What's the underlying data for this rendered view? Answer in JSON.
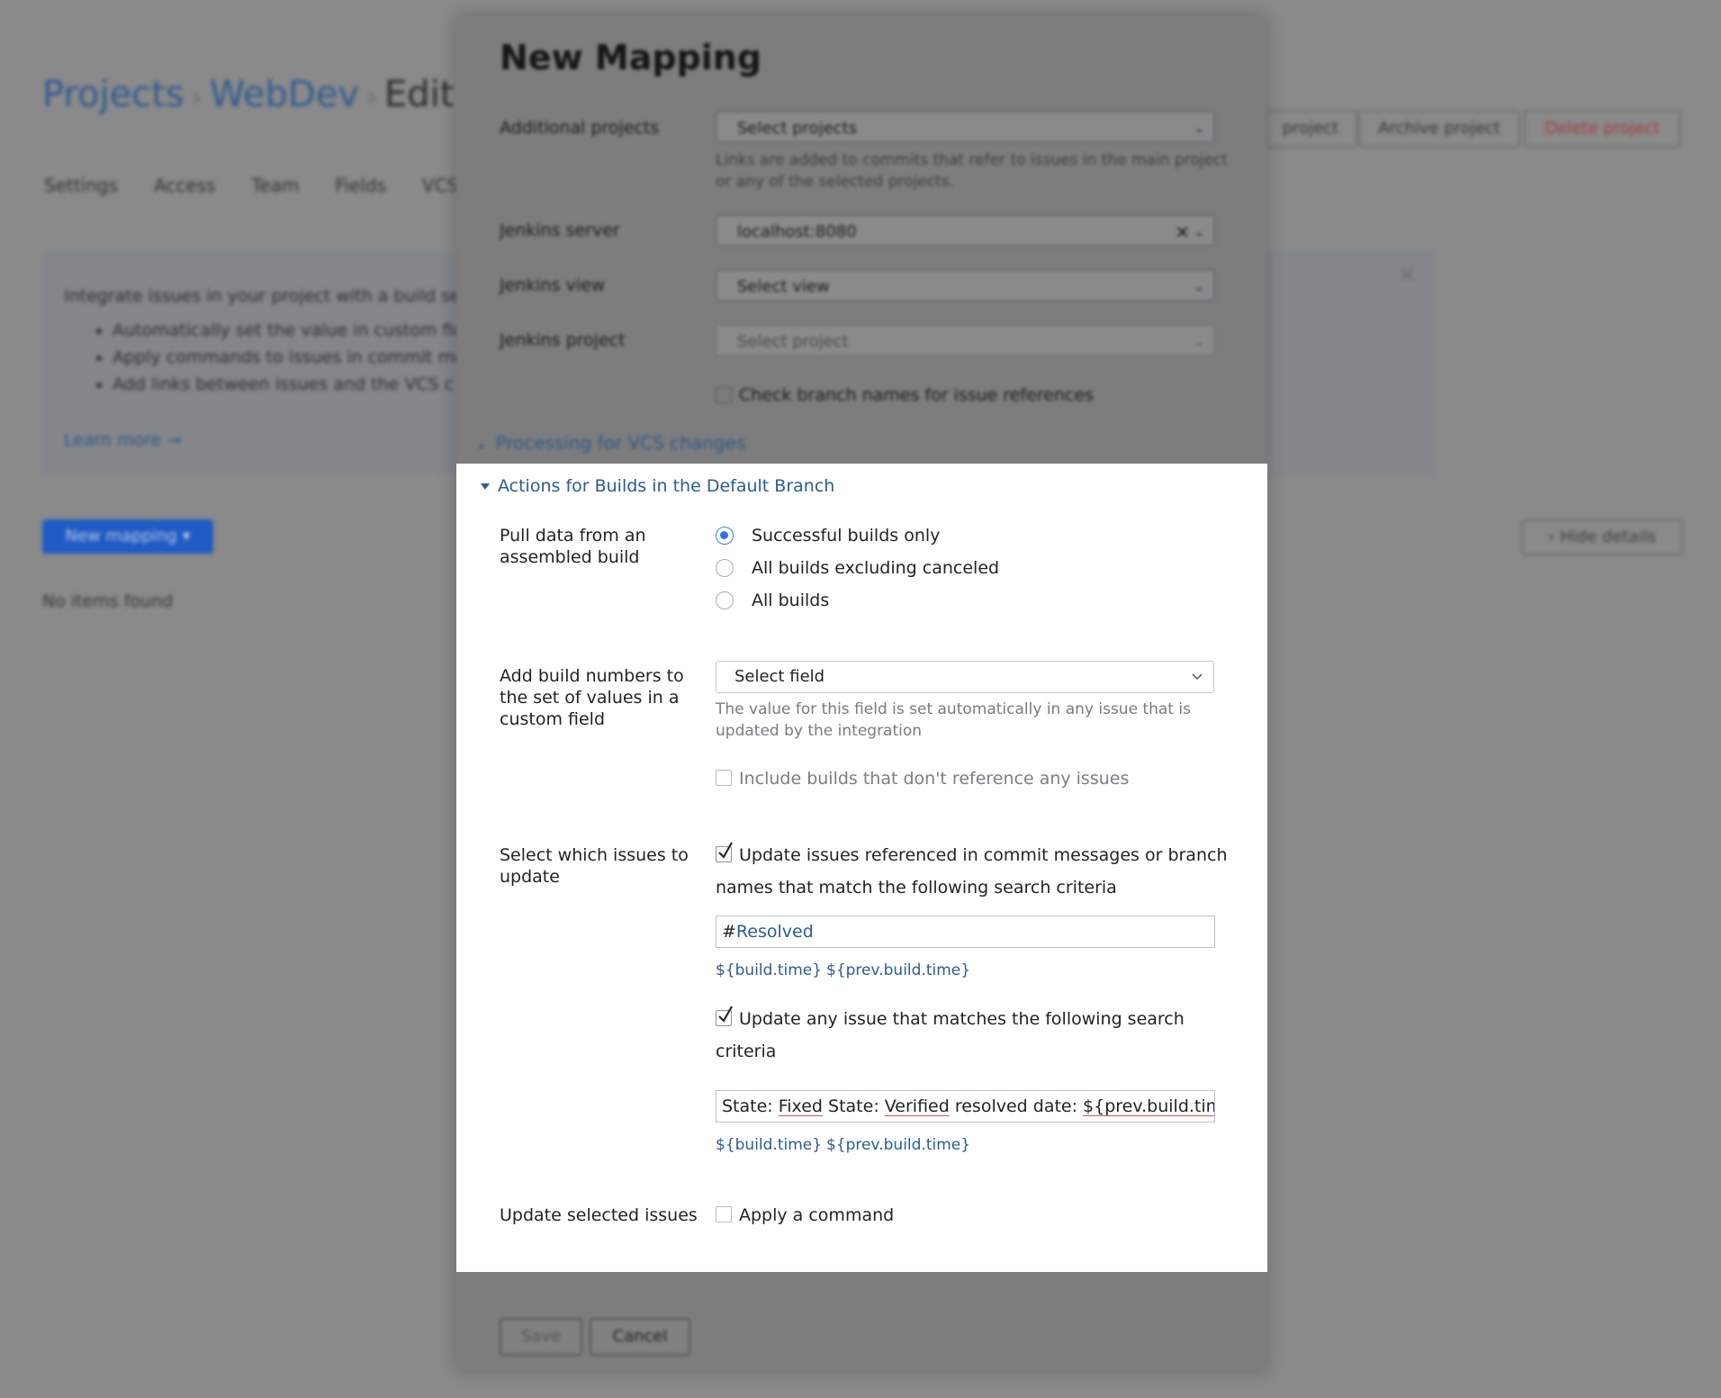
{
  "background": {
    "breadcrumb": {
      "projects": "Projects",
      "sep": "›",
      "webdev": "WebDev",
      "current": "Edit Pro"
    },
    "tabs": [
      "Settings",
      "Access",
      "Team",
      "Fields",
      "VCS"
    ],
    "header_buttons": {
      "project": "project",
      "archive": "Archive project",
      "delete": "Delete project"
    },
    "info": {
      "intro": "Integrate issues in your project with a build ser",
      "bullets": [
        "Automatically set the value in custom fie",
        "Apply commands to issues in commit me",
        "Add links between issues and the VCS c"
      ],
      "learn_more": "Learn more →",
      "close": "✕"
    },
    "new_mapping": "New mapping ▾",
    "hide_details": "› Hide details",
    "no_items": "No items found"
  },
  "modal": {
    "title": "New Mapping",
    "additional_projects": {
      "label": "Additional projects",
      "value": "Select projects",
      "hint": "Links are added to commits that refer to issues in the main project or any of the selected projects."
    },
    "jenkins_server": {
      "label": "Jenkins server",
      "value": "localhost:8080",
      "clear": "✕"
    },
    "jenkins_view": {
      "label": "Jenkins view",
      "value": "Select view"
    },
    "jenkins_project": {
      "label": "Jenkins project",
      "value": "Select project"
    },
    "check_branch": "Check branch names for issue references",
    "processing_vcs": "Processing for VCS changes",
    "buttons": {
      "save": "Save",
      "cancel": "Cancel"
    }
  },
  "panel": {
    "section_title": "Actions for Builds in the Default Branch",
    "pull_data": {
      "label_line1": "Pull data from an",
      "label_line2": "assembled build",
      "options": [
        "Successful builds only",
        "All builds excluding canceled",
        "All builds"
      ],
      "selected": "Successful builds only"
    },
    "build_numbers": {
      "label_line1": "Add build numbers to",
      "label_line2": "the set of values in a",
      "label_line3": "custom field",
      "select_value": "Select field",
      "hint": "The value for this field is set automatically in any issue that is updated by the integration",
      "include_label": "Include builds that don't reference any issues",
      "include_checked": false
    },
    "select_issues": {
      "label_line1": "Select which issues to",
      "label_line2": "update",
      "update_referenced": {
        "checked": true,
        "line1": "Update issues referenced in commit messages or branch",
        "line2": "names that match the following search criteria",
        "query_hash": "#",
        "query_rest": "Resolved",
        "vars": [
          "${build.time}",
          "${prev.build.time}"
        ]
      },
      "update_any": {
        "checked": true,
        "line1": "Update any issue that matches the following search",
        "line2": "criteria",
        "query_parts": [
          "State: ",
          "Fixed",
          " State: ",
          "Verified",
          " resolved date: ",
          "${prev.build.time}"
        ],
        "vars": [
          "${build.time}",
          "${prev.build.time}"
        ]
      }
    },
    "update_selected": {
      "label": "Update selected issues",
      "apply_command": "Apply a command",
      "checked": false
    }
  }
}
